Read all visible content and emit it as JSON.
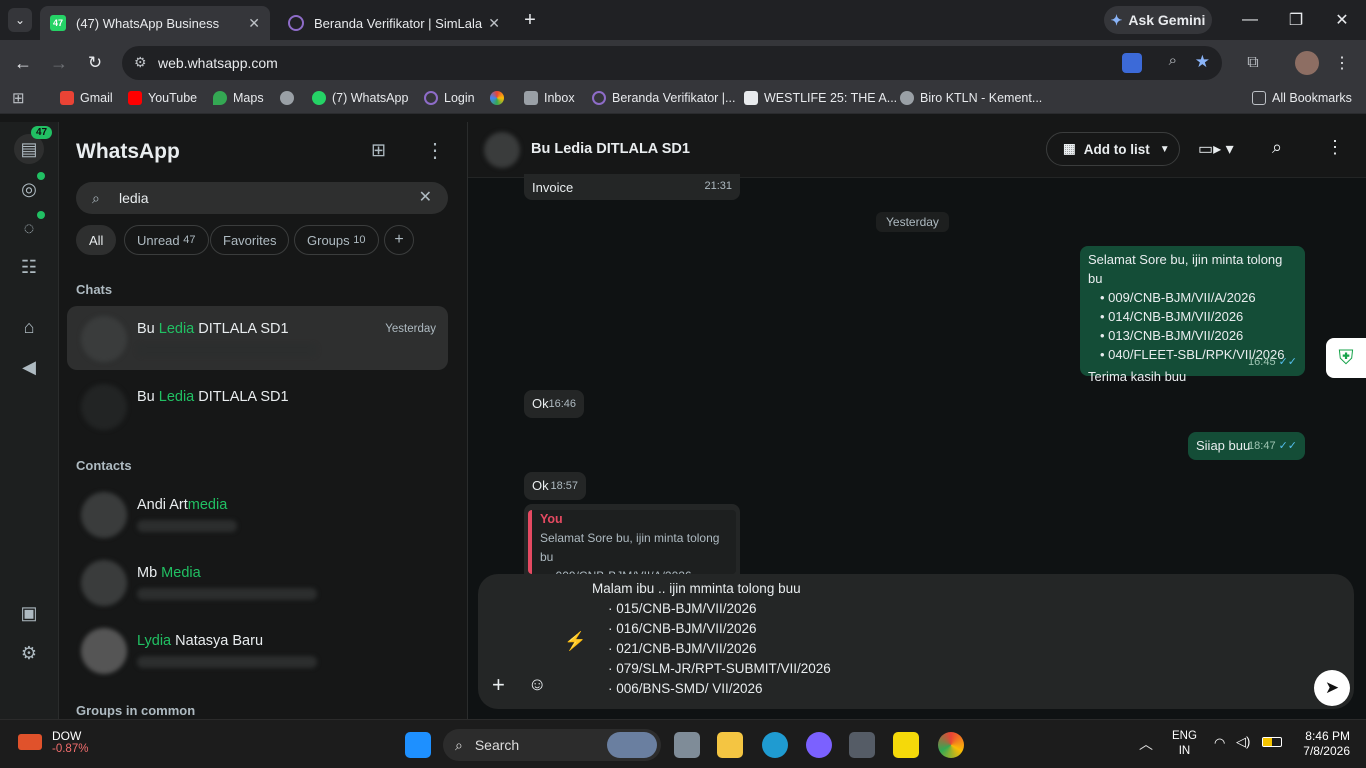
{
  "browser": {
    "tabs": [
      {
        "label": "(47) WhatsApp Business",
        "badge": "47",
        "active": true
      },
      {
        "label": "Beranda Verifikator | SimLala",
        "active": false
      }
    ],
    "new_tab": "+",
    "ask_gemini": "Ask Gemini",
    "url": "web.whatsapp.com",
    "bookmarks": [
      {
        "label": "Gmail",
        "color": "#ea4335"
      },
      {
        "label": "YouTube",
        "color": "#ff0000"
      },
      {
        "label": "Maps",
        "color": "#34a853"
      },
      {
        "label": "",
        "color": "#9aa0a6"
      },
      {
        "label": "(7) WhatsApp",
        "color": "#25d366"
      },
      {
        "label": "Login",
        "color": "#8e6cc8"
      },
      {
        "label": "",
        "color": "#fbbc05"
      },
      {
        "label": "Inbox",
        "color": "#9aa0a6"
      },
      {
        "label": "Beranda Verifikator |...",
        "color": "#8e6cc8"
      },
      {
        "label": "WESTLIFE 25: THE A...",
        "color": "#e8eaed"
      },
      {
        "label": "Biro KTLN - Kement...",
        "color": "#9aa0a6"
      }
    ],
    "all_bookmarks": "All Bookmarks"
  },
  "rail": {
    "badge": "47"
  },
  "sidebar": {
    "title": "WhatsApp",
    "search_value": "ledia",
    "filters": [
      {
        "label": "All",
        "count": ""
      },
      {
        "label": "Unread",
        "count": "47"
      },
      {
        "label": "Favorites",
        "count": ""
      },
      {
        "label": "Groups",
        "count": "10"
      }
    ],
    "chats_heading": "Chats",
    "chats": [
      {
        "pre": "Bu ",
        "hl": "Ledia",
        "post": " DITLALA SD1",
        "time": "Yesterday"
      },
      {
        "pre": "Bu ",
        "hl": "Ledia",
        "post": " DITLALA SD1",
        "time": ""
      }
    ],
    "contacts_heading": "Contacts",
    "contacts": [
      {
        "pre": "Andi Art",
        "hl": "media",
        "post": ""
      },
      {
        "pre": "Mb ",
        "hl": "Media",
        "post": ""
      },
      {
        "pre": "",
        "hl": "Lydia",
        "post": " Natasya Baru"
      }
    ],
    "groups_heading": "Groups in common"
  },
  "chat": {
    "contact_name": "Bu Ledia DITLALA SD1",
    "add_to_list": "Add to list",
    "messages": {
      "invoice_text": "Invoice",
      "invoice_time": "21:31",
      "day": "Yesterday",
      "out1_line0": "Selamat Sore bu, ijin minta tolong bu",
      "out1_items": [
        "009/CNB-BJM/VII/A/2026",
        "014/CNB-BJM/VII/2026",
        "013/CNB-BJM/VII/2026",
        "040/FLEET-SBL/RPK/VII/2026"
      ],
      "out1_end": "Terima kasih buu",
      "out1_time": "16:45",
      "in1_text": "Ok",
      "in1_time": "16:46",
      "out2_text": "Siiap buu",
      "out2_time": "18:47",
      "in2_text": "Ok",
      "in2_time": "18:57",
      "reply_author": "You",
      "reply_text": "Selamat Sore bu, ijin minta tolong bu",
      "reply_item": "009/CNB-BJM/VII/A/2026..."
    },
    "composer": {
      "line0": "Malam ibu .. ijin mminta tolong buu",
      "items": [
        "015/CNB-BJM/VII/2026",
        "016/CNB-BJM/VII/2026",
        "021/CNB-BJM/VII/2026",
        "079/SLM-JR/RPT-SUBMIT/VII/2026",
        "006/BNS-SMD/ VII/2026"
      ]
    }
  },
  "taskbar": {
    "stock_name": "DOW",
    "stock_change": "-0.87%",
    "search": "Search",
    "lang1": "ENG",
    "lang2": "IN",
    "time": "8:46 PM",
    "date": "7/8/2026"
  }
}
